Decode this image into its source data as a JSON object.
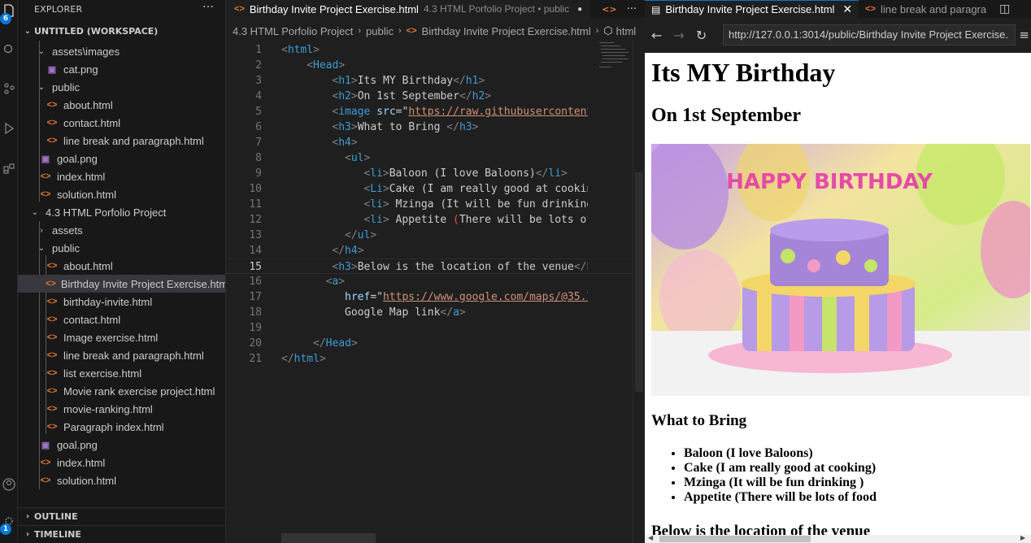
{
  "activity_bar": {
    "explorer_badge": "6",
    "accounts_badge": "1"
  },
  "explorer": {
    "header": "EXPLORER",
    "workspace": "UNTITLED (WORKSPACE)",
    "tree": [
      {
        "label": "assets\\images",
        "type": "folder",
        "depth": 1,
        "open": true
      },
      {
        "label": "cat.png",
        "type": "png",
        "depth": 2
      },
      {
        "label": "public",
        "type": "folder",
        "depth": 1,
        "open": true
      },
      {
        "label": "about.html",
        "type": "html",
        "depth": 2
      },
      {
        "label": "contact.html",
        "type": "html",
        "depth": 2
      },
      {
        "label": "line break and paragraph.html",
        "type": "html",
        "depth": 2
      },
      {
        "label": "goal.png",
        "type": "png",
        "depth": 1
      },
      {
        "label": "index.html",
        "type": "html",
        "depth": 1
      },
      {
        "label": "solution.html",
        "type": "html",
        "depth": 1
      },
      {
        "label": "4.3 HTML Porfolio Project",
        "type": "folder",
        "depth": 0,
        "open": true
      },
      {
        "label": "assets",
        "type": "folder",
        "depth": 1,
        "open": false
      },
      {
        "label": "public",
        "type": "folder",
        "depth": 1,
        "open": true
      },
      {
        "label": "about.html",
        "type": "html",
        "depth": 2
      },
      {
        "label": "Birthday Invite Project Exercise.html",
        "type": "html",
        "depth": 2,
        "selected": true
      },
      {
        "label": "birthday-invite.html",
        "type": "html",
        "depth": 2
      },
      {
        "label": "contact.html",
        "type": "html",
        "depth": 2
      },
      {
        "label": "Image exercise.html",
        "type": "html",
        "depth": 2
      },
      {
        "label": "line break and paragraph.html",
        "type": "html",
        "depth": 2
      },
      {
        "label": "list exercise.html",
        "type": "html",
        "depth": 2
      },
      {
        "label": "Movie rank exercise project.html",
        "type": "html",
        "depth": 2
      },
      {
        "label": "movie-ranking.html",
        "type": "html",
        "depth": 2
      },
      {
        "label": "Paragraph index.html",
        "type": "html",
        "depth": 2
      },
      {
        "label": "goal.png",
        "type": "png",
        "depth": 1
      },
      {
        "label": "index.html",
        "type": "html",
        "depth": 1
      },
      {
        "label": "solution.html",
        "type": "html",
        "depth": 1
      }
    ],
    "outline": "OUTLINE",
    "timeline": "TIMELINE"
  },
  "editor": {
    "tab_title": "Birthday Invite Project Exercise.html",
    "tab_desc": "4.3 HTML Porfolio Project • public",
    "breadcrumb": [
      "4.3 HTML Porfolio Project",
      "public",
      "Birthday Invite Project Exercise.html",
      "html"
    ],
    "active_line": 15,
    "lines": [
      {
        "n": "1",
        "indent": 0,
        "tokens": [
          {
            "t": "br",
            "v": "<"
          },
          {
            "t": "tag",
            "v": "html"
          },
          {
            "t": "br",
            "v": ">"
          }
        ]
      },
      {
        "n": "2",
        "indent": 4,
        "tokens": [
          {
            "t": "br",
            "v": "<"
          },
          {
            "t": "tag",
            "v": "Head"
          },
          {
            "t": "br",
            "v": ">"
          }
        ]
      },
      {
        "n": "3",
        "indent": 8,
        "tokens": [
          {
            "t": "br",
            "v": "<"
          },
          {
            "t": "tag",
            "v": "h1"
          },
          {
            "t": "br",
            "v": ">"
          },
          {
            "t": "txt",
            "v": "Its MY Birthday"
          },
          {
            "t": "br",
            "v": "</"
          },
          {
            "t": "tag",
            "v": "h1"
          },
          {
            "t": "br",
            "v": ">"
          }
        ]
      },
      {
        "n": "4",
        "indent": 8,
        "tokens": [
          {
            "t": "br",
            "v": "<"
          },
          {
            "t": "tag",
            "v": "h2"
          },
          {
            "t": "br",
            "v": ">"
          },
          {
            "t": "txt",
            "v": "On 1st September"
          },
          {
            "t": "br",
            "v": "</"
          },
          {
            "t": "tag",
            "v": "h2"
          },
          {
            "t": "br",
            "v": ">"
          }
        ]
      },
      {
        "n": "5",
        "indent": 8,
        "tokens": [
          {
            "t": "br",
            "v": "<"
          },
          {
            "t": "tag",
            "v": "image"
          },
          {
            "t": "txt",
            "v": " "
          },
          {
            "t": "attr",
            "v": "src"
          },
          {
            "t": "txt",
            "v": "=\""
          },
          {
            "t": "str",
            "v": "https://raw.githubusercontent"
          }
        ]
      },
      {
        "n": "6",
        "indent": 8,
        "tokens": [
          {
            "t": "br",
            "v": "<"
          },
          {
            "t": "tag",
            "v": "h3"
          },
          {
            "t": "br",
            "v": ">"
          },
          {
            "t": "txt",
            "v": "What to Bring "
          },
          {
            "t": "br",
            "v": "</"
          },
          {
            "t": "tag",
            "v": "h3"
          },
          {
            "t": "br",
            "v": ">"
          }
        ]
      },
      {
        "n": "7",
        "indent": 8,
        "tokens": [
          {
            "t": "br",
            "v": "<"
          },
          {
            "t": "tag",
            "v": "h4"
          },
          {
            "t": "br",
            "v": ">"
          }
        ]
      },
      {
        "n": "8",
        "indent": 10,
        "tokens": [
          {
            "t": "br",
            "v": "<"
          },
          {
            "t": "tag",
            "v": "ul"
          },
          {
            "t": "br",
            "v": ">"
          }
        ]
      },
      {
        "n": "9",
        "indent": 13,
        "tokens": [
          {
            "t": "br",
            "v": "<"
          },
          {
            "t": "tag",
            "v": "li"
          },
          {
            "t": "br",
            "v": ">"
          },
          {
            "t": "txt",
            "v": "Baloon (I love Baloons)"
          },
          {
            "t": "br",
            "v": "</"
          },
          {
            "t": "tag",
            "v": "li"
          },
          {
            "t": "br",
            "v": ">"
          }
        ]
      },
      {
        "n": "10",
        "indent": 13,
        "tokens": [
          {
            "t": "br",
            "v": "<"
          },
          {
            "t": "tag",
            "v": "Li"
          },
          {
            "t": "br",
            "v": ">"
          },
          {
            "t": "txt",
            "v": "Cake (I am really good at cookin"
          }
        ]
      },
      {
        "n": "11",
        "indent": 13,
        "tokens": [
          {
            "t": "br",
            "v": "<"
          },
          {
            "t": "tag",
            "v": "li"
          },
          {
            "t": "br",
            "v": ">"
          },
          {
            "t": "txt",
            "v": " Mzinga (It will be fun drinking"
          }
        ]
      },
      {
        "n": "12",
        "indent": 13,
        "tokens": [
          {
            "t": "br",
            "v": "<"
          },
          {
            "t": "tag",
            "v": "li"
          },
          {
            "t": "br",
            "v": ">"
          },
          {
            "t": "txt",
            "v": " Appetite "
          },
          {
            "t": "red",
            "v": "("
          },
          {
            "t": "txt",
            "v": "There will be lots of"
          }
        ]
      },
      {
        "n": "13",
        "indent": 10,
        "tokens": [
          {
            "t": "br",
            "v": "</"
          },
          {
            "t": "tag",
            "v": "ul"
          },
          {
            "t": "br",
            "v": ">"
          }
        ]
      },
      {
        "n": "14",
        "indent": 8,
        "tokens": [
          {
            "t": "br",
            "v": "</"
          },
          {
            "t": "tag",
            "v": "h4"
          },
          {
            "t": "br",
            "v": ">"
          }
        ]
      },
      {
        "n": "15",
        "indent": 8,
        "tokens": [
          {
            "t": "br",
            "v": "<"
          },
          {
            "t": "tag",
            "v": "h3"
          },
          {
            "t": "br",
            "v": ">"
          },
          {
            "t": "txt",
            "v": "Below is the location of the venue"
          },
          {
            "t": "br",
            "v": "</"
          },
          {
            "t": "tag",
            "v": "h"
          }
        ]
      },
      {
        "n": "16",
        "indent": 7,
        "tokens": [
          {
            "t": "br",
            "v": "<"
          },
          {
            "t": "tag",
            "v": "a"
          },
          {
            "t": "br",
            "v": ">"
          }
        ]
      },
      {
        "n": "17",
        "indent": 10,
        "tokens": [
          {
            "t": "attr",
            "v": "href"
          },
          {
            "t": "txt",
            "v": "=\""
          },
          {
            "t": "str",
            "v": "https://www.google.com/maps/@35.7"
          }
        ]
      },
      {
        "n": "18",
        "indent": 10,
        "tokens": [
          {
            "t": "txt",
            "v": "Google Map link"
          },
          {
            "t": "br",
            "v": "</"
          },
          {
            "t": "tag",
            "v": "a"
          },
          {
            "t": "br",
            "v": ">"
          }
        ]
      },
      {
        "n": "19",
        "indent": 0,
        "tokens": []
      },
      {
        "n": "20",
        "indent": 5,
        "tokens": [
          {
            "t": "br",
            "v": "</"
          },
          {
            "t": "tag",
            "v": "Head"
          },
          {
            "t": "br",
            "v": ">"
          }
        ]
      },
      {
        "n": "21",
        "indent": 0,
        "tokens": [
          {
            "t": "br",
            "v": "</"
          },
          {
            "t": "tag",
            "v": "html"
          },
          {
            "t": "br",
            "v": ">"
          }
        ]
      }
    ]
  },
  "browser": {
    "tab_active": "Birthday Invite Project Exercise.html",
    "tab_inactive": "line break and paragra",
    "url": "http://127.0.0.1:3014/public/Birthday Invite Project Exercise.",
    "page": {
      "h1": "Its MY Birthday",
      "h2": "On 1st September",
      "image_text": "HAPPY BIRTHDAY",
      "h3_bring": "What to Bring",
      "items": [
        "Baloon (I love Baloons)",
        "Cake (I am really good at cooking)",
        "Mzinga (It will be fun drinking )",
        "Appetite (There will be lots of food"
      ],
      "h3_location": "Below is the location of the venue"
    }
  }
}
